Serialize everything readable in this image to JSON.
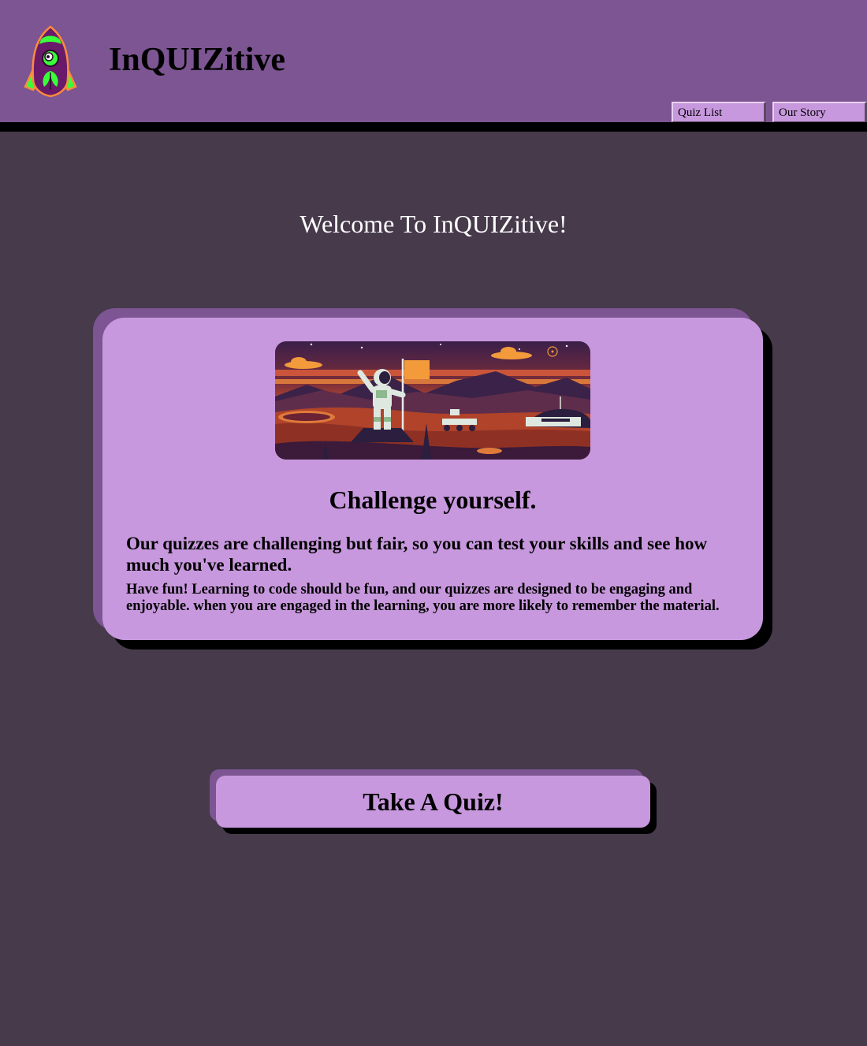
{
  "header": {
    "title": "InQUIZitive",
    "logo_icon": "rocket-icon",
    "nav": [
      {
        "label": "Quiz List"
      },
      {
        "label": "Our Story"
      }
    ]
  },
  "main": {
    "welcome": "Welcome To InQUIZitive!",
    "card": {
      "image_icon": "astronaut-on-mars-illustration",
      "heading": "Challenge yourself.",
      "lead": "Our quizzes are challenging but fair, so you can test your skills and see how much you've learned.",
      "body": "Have fun! Learning to code should be fun, and our quizzes are designed to be engaging and enjoyable. when you are engaged in the learning, you are more likely to remember the material."
    },
    "cta_label": "Take A Quiz!"
  },
  "colors": {
    "header_bg": "#7c5592",
    "page_bg": "#463a4b",
    "card_bg": "#c898de",
    "accent_green": "#39ff3a"
  }
}
